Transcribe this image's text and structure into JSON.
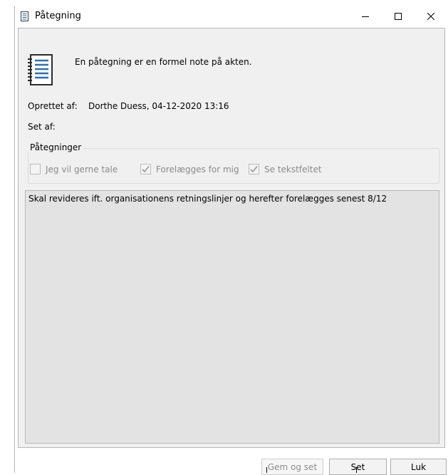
{
  "window": {
    "title": "Påtegning",
    "icon": "notebook-icon",
    "controls": [
      "minimize-icon",
      "maximize-icon",
      "close-icon"
    ]
  },
  "header": {
    "icon": "notebook-icon",
    "description": "En påtegning er en formel note på akten."
  },
  "meta": {
    "created_label": "Oprettet af:",
    "created_value": "Dorthe Duess, 04-12-2020 13:16",
    "seen_label": "Set af:",
    "seen_value": ""
  },
  "group": {
    "title": "Påtegninger",
    "options": [
      {
        "label": "Jeg vil gerne tale",
        "checked": false
      },
      {
        "label": "Forelægges for mig",
        "checked": true
      },
      {
        "label": "Se tekstfeltet",
        "checked": true
      }
    ]
  },
  "note": {
    "text": "Skal revideres ift. organisationens retningslinjer og herefter forelægges senest 8/12"
  },
  "buttons": {
    "save_and_seen": "Gem og set",
    "seen": "Set",
    "close": "Luk"
  }
}
